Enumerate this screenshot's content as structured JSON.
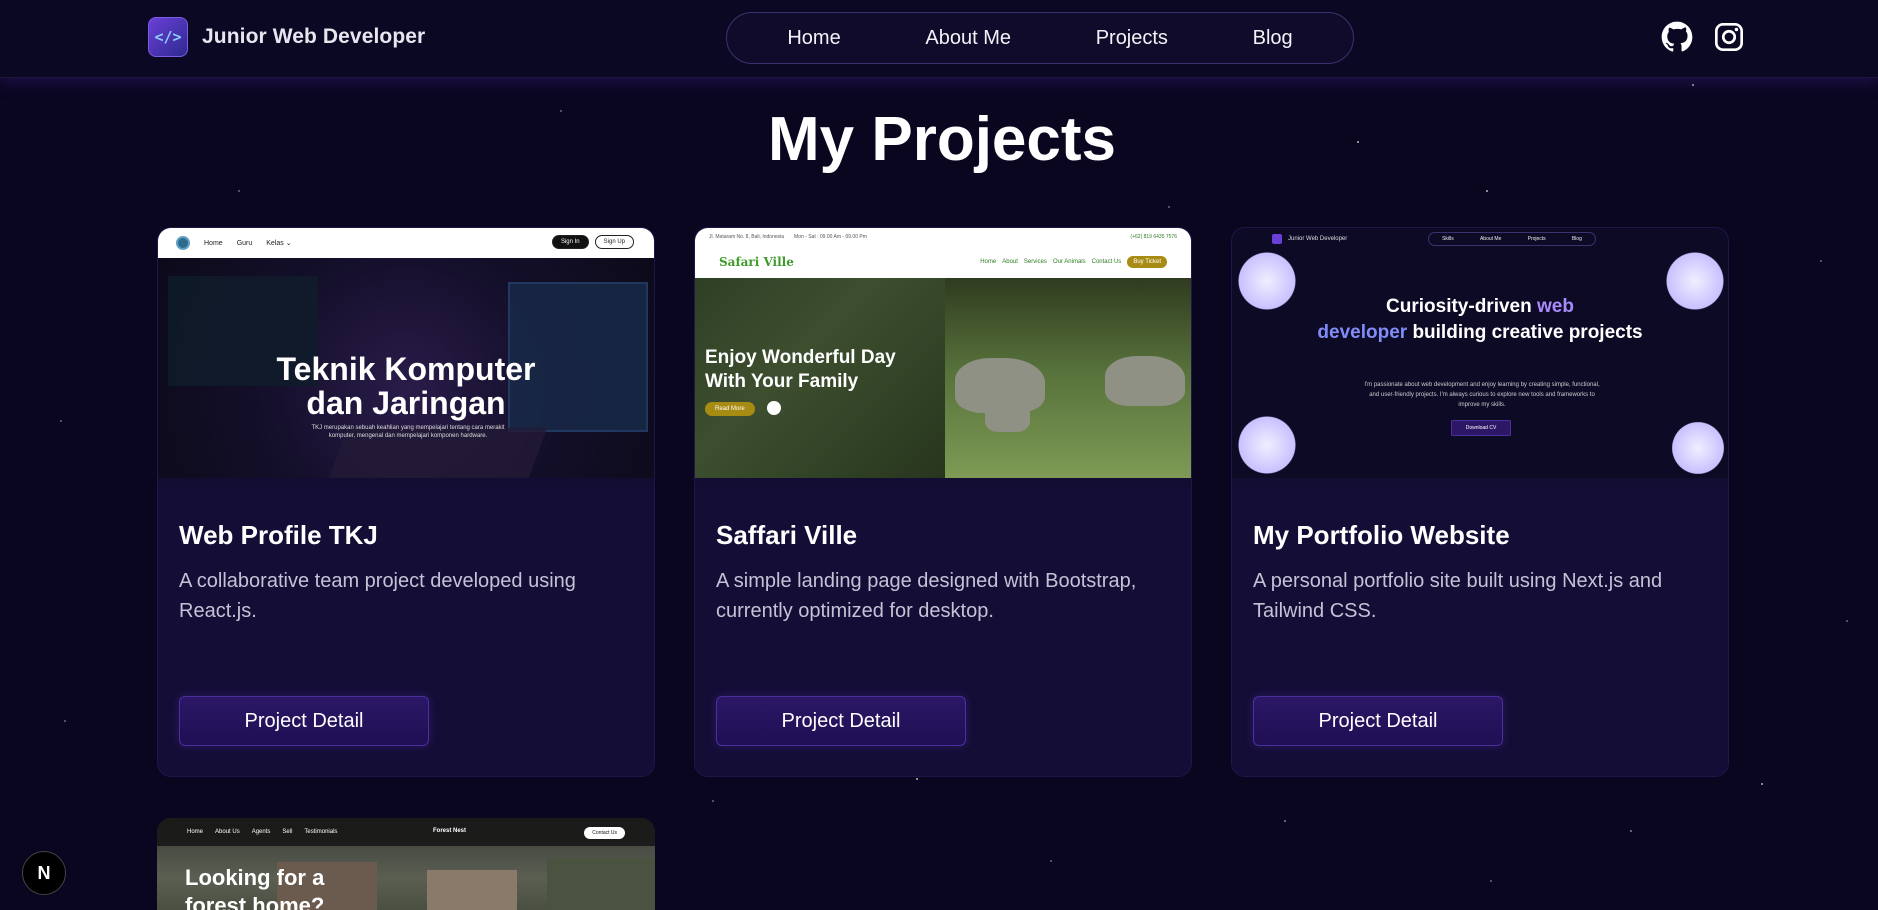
{
  "nav": {
    "brand_name": "Junior Web Developer",
    "brand_logo_text": "</>",
    "links": [
      "Home",
      "About Me",
      "Projects",
      "Blog"
    ],
    "socials": [
      "github-icon",
      "instagram-icon"
    ]
  },
  "page": {
    "title": "My Projects"
  },
  "projects": [
    {
      "title": "Web Profile TKJ",
      "description": "A collaborative team project developed using React.js.",
      "button": "Project Detail",
      "thumb": {
        "nav_links": [
          "Home",
          "Guru",
          "Kelas ⌄"
        ],
        "sign_in": "Sign In",
        "sign_up": "Sign Up",
        "headline": "Teknik Komputer dan Jaringan",
        "subtext": "TKJ merupakan sebuah keahlian yang mempelajari tentang cara merakit komputer, mengenal dan mempelajari komponen hardware."
      }
    },
    {
      "title": "Saffari Ville",
      "description": "A simple landing page designed with Bootstrap, currently optimized for desktop.",
      "button": "Project Detail",
      "thumb": {
        "address": "Jl. Mataram No. 8, Bali, Indonesia",
        "hours": "Mon - Sat : 09.00 Am - 09.00 Pm",
        "phone": "(+62) 819 6435 7576",
        "brand": "Safari Ville",
        "nav_links": [
          "Home",
          "About",
          "Services",
          "Our Animals",
          "Contact Us"
        ],
        "ticket": "Buy Ticket",
        "headline": "Enjoy Wonderful Day With Your Family",
        "read_more": "Read More"
      }
    },
    {
      "title": "My Portfolio Website",
      "description": "A personal portfolio site built using Next.js and Tailwind CSS.",
      "button": "Project Detail",
      "thumb": {
        "brand": "Junior Web Developer",
        "nav_links": [
          "Skills",
          "About Me",
          "Projects",
          "Blog"
        ],
        "headline_pre": "Curiosity-driven",
        "headline_acc1": "web",
        "headline_acc2": "developer",
        "headline_post": "building creative projects",
        "subtext": "I'm passionate about web development and enjoy learning by creating simple, functional, and user-friendly projects. I'm always curious to explore new tools and frameworks to improve my skills.",
        "cta": "Download CV"
      }
    },
    {
      "thumb": {
        "nav_links": [
          "Home",
          "About Us",
          "Agents",
          "Sell",
          "Testimonials"
        ],
        "brand": "Forest Nest",
        "contact": "Contact Us",
        "headline": "Looking for a forest home?"
      }
    }
  ],
  "next_badge": "N"
}
